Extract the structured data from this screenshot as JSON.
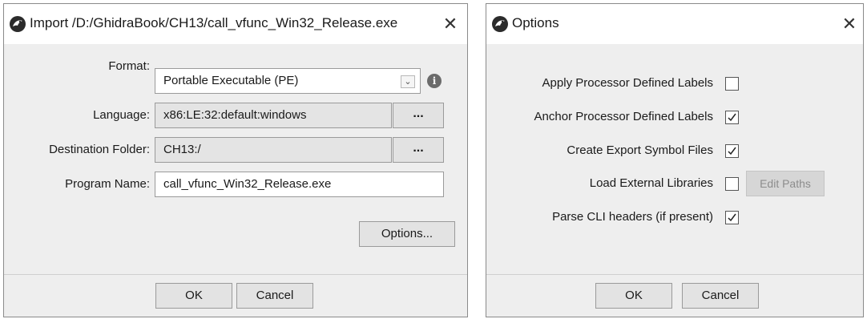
{
  "import_dialog": {
    "title": "Import /D:/GhidraBook/CH13/call_vfunc_Win32_Release.exe",
    "close_glyph": "✕",
    "format_label": "Format:",
    "format_value": "Portable Executable (PE)",
    "language_label": "Language:",
    "language_value": "x86:LE:32:default:windows",
    "destination_label": "Destination Folder:",
    "destination_value": "CH13:/",
    "program_name_label": "Program Name:",
    "program_name_value": "call_vfunc_Win32_Release.exe",
    "browse_label": "...",
    "options_button": "Options...",
    "ok_button": "OK",
    "cancel_button": "Cancel",
    "info_glyph": "i",
    "dropdown_glyph": "⌄"
  },
  "options_dialog": {
    "title": "Options",
    "close_glyph": "✕",
    "options": [
      {
        "label": "Apply Processor Defined Labels",
        "checked": false
      },
      {
        "label": "Anchor Processor Defined Labels",
        "checked": true
      },
      {
        "label": "Create Export Symbol Files",
        "checked": true
      },
      {
        "label": "Load External Libraries",
        "checked": false
      },
      {
        "label": "Parse CLI headers (if present)",
        "checked": true
      }
    ],
    "edit_paths_button": "Edit Paths",
    "ok_button": "OK",
    "cancel_button": "Cancel"
  },
  "icons": {
    "app_icon": "ghidra-dragon-icon",
    "info_icon": "info-icon",
    "checkmark": "checkmark-icon"
  }
}
